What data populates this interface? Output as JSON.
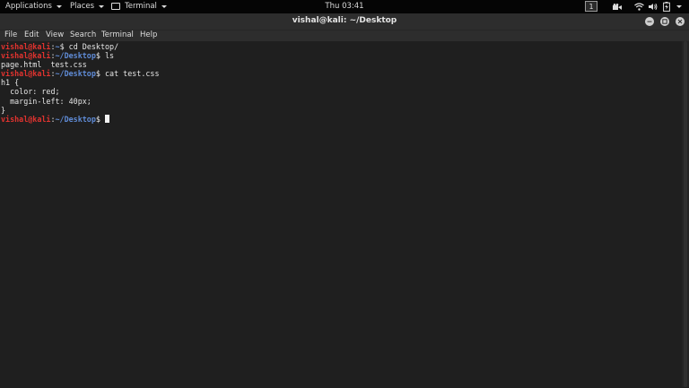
{
  "topbar": {
    "applications": "Applications",
    "places": "Places",
    "terminal": "Terminal",
    "clock": "Thu 03:41",
    "workspace": "1",
    "icons": [
      "applications-caret-icon",
      "places-caret-icon",
      "terminal-icon",
      "screen-recorder-icon",
      "wifi-icon",
      "volume-icon",
      "battery-icon",
      "power-menu-icon"
    ]
  },
  "window": {
    "title": "vishal@kali: ~/Desktop",
    "menu": [
      "File",
      "Edit",
      "View",
      "Search",
      "Terminal",
      "Help"
    ]
  },
  "terminal": {
    "lines": [
      {
        "user": "vishal@kali",
        "sep": ":",
        "path": "~",
        "prompt": "$ ",
        "cmd": "cd Desktop/"
      },
      {
        "user": "vishal@kali",
        "sep": ":",
        "path": "~/Desktop",
        "prompt": "$ ",
        "cmd": "ls"
      },
      {
        "out": "page.html  test.css"
      },
      {
        "user": "vishal@kali",
        "sep": ":",
        "path": "~/Desktop",
        "prompt": "$ ",
        "cmd": "cat test.css"
      },
      {
        "out": "h1 {"
      },
      {
        "out": "  color: red;"
      },
      {
        "out": "  margin-left: 40px;"
      },
      {
        "out": "}"
      },
      {
        "user": "vishal@kali",
        "sep": ":",
        "path": "~/Desktop",
        "prompt": "$ ",
        "cmd": ""
      }
    ]
  },
  "colors": {
    "prompt_user": "#e1332f",
    "prompt_path": "#5f8bd6",
    "terminal_bg": "#1f1f1f",
    "text": "#e6e6e6"
  }
}
